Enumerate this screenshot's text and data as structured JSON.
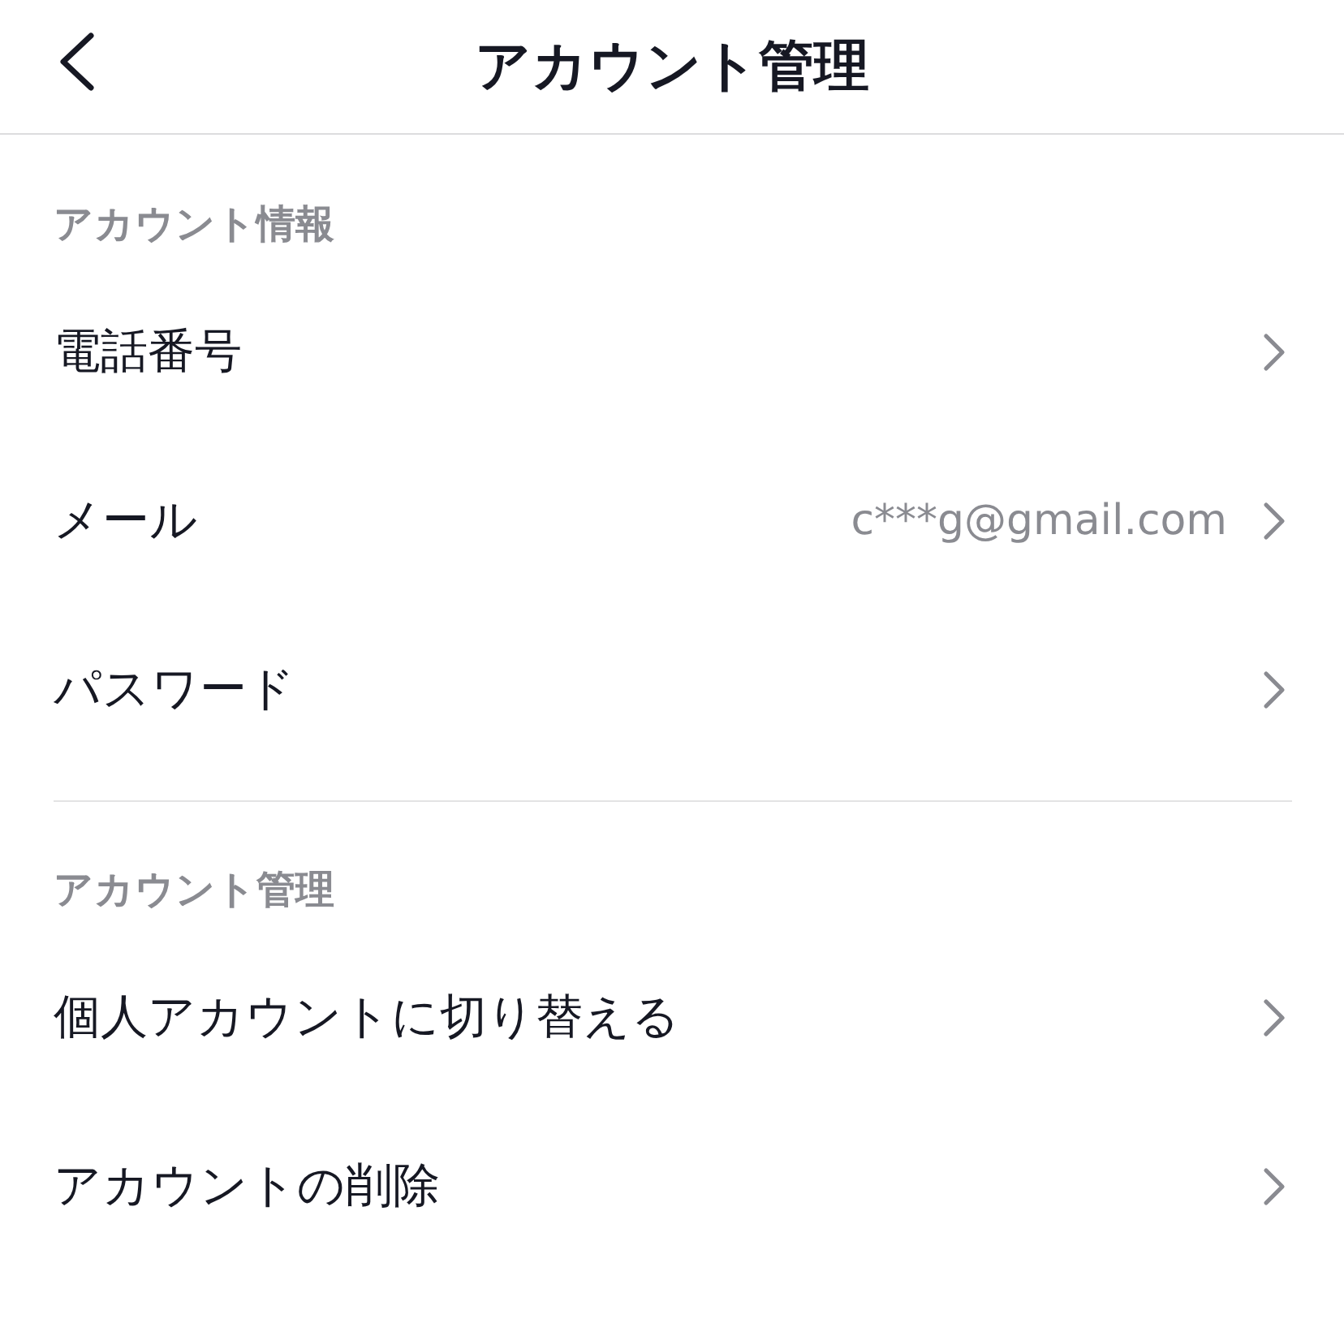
{
  "header": {
    "title": "アカウント管理"
  },
  "sections": [
    {
      "title": "アカウント情報",
      "items": [
        {
          "label": "電話番号"
        },
        {
          "label": "メール",
          "value": "c***g@gmail.com"
        },
        {
          "label": "パスワード"
        }
      ]
    },
    {
      "title": "アカウント管理",
      "items": [
        {
          "label": "個人アカウントに切り替える"
        },
        {
          "label": "アカウントの削除"
        }
      ]
    }
  ]
}
